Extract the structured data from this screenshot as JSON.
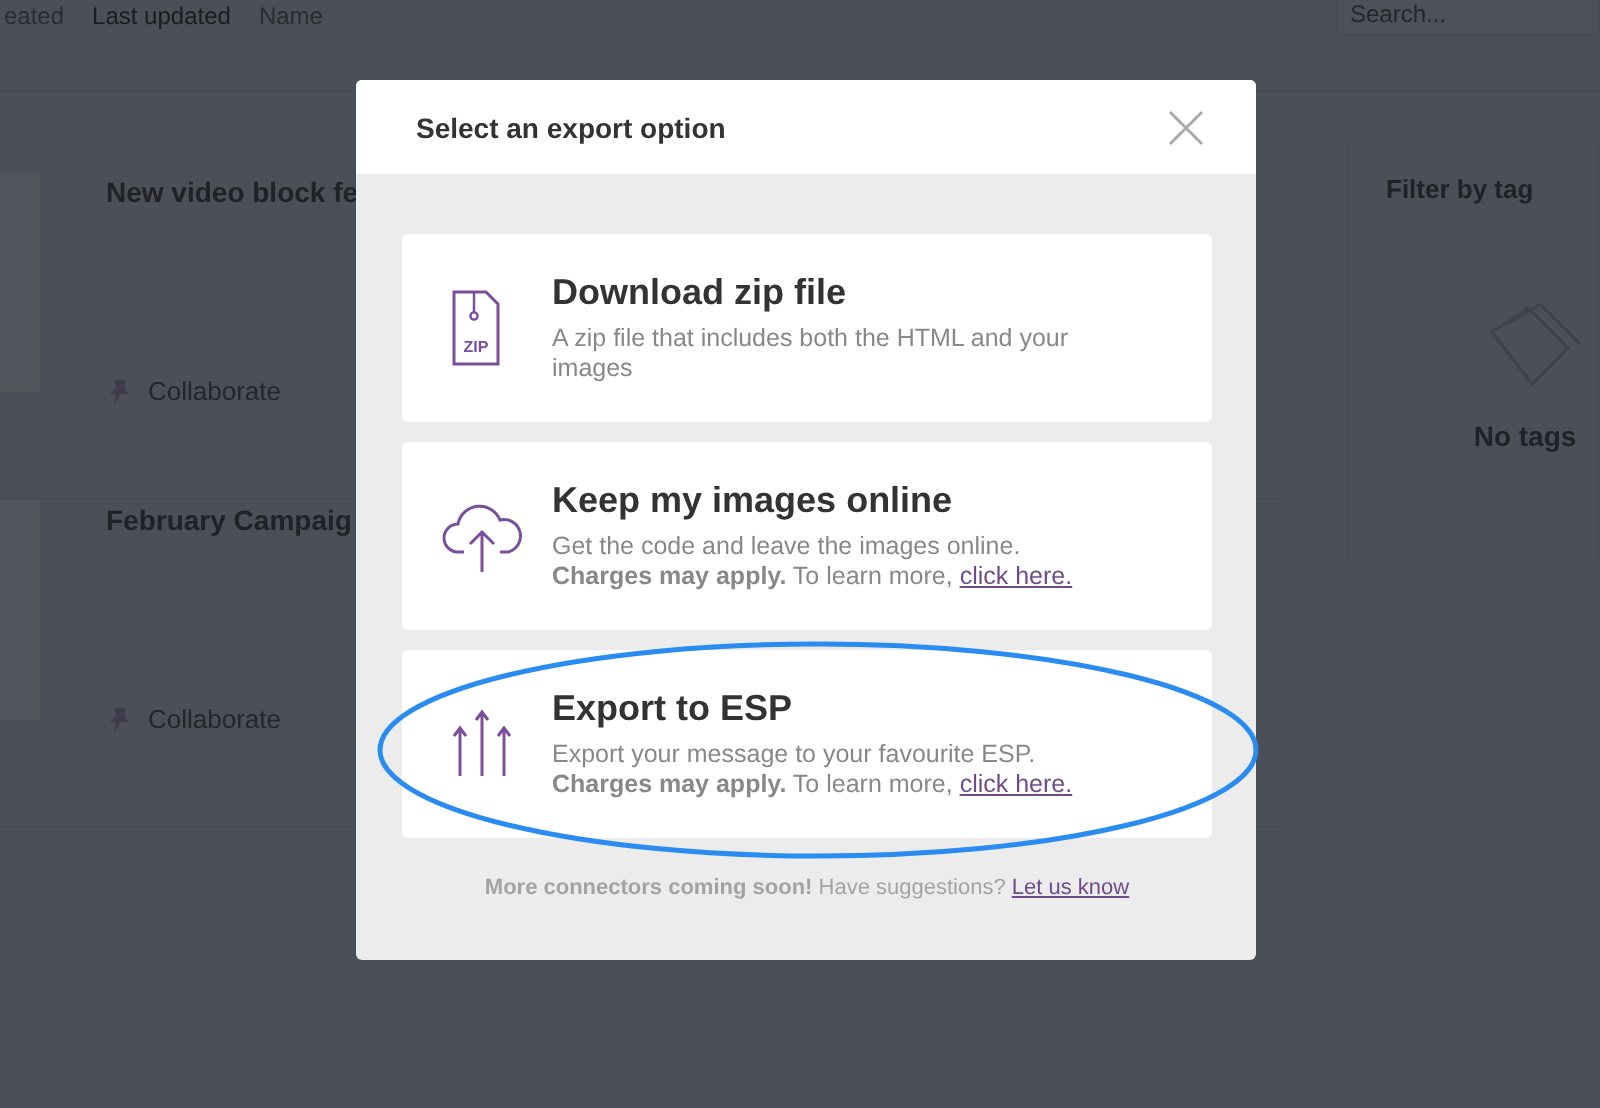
{
  "background": {
    "sort_options": [
      {
        "label": "eated",
        "selected": false
      },
      {
        "label": "Last updated",
        "selected": true
      },
      {
        "label": "Name",
        "selected": false
      }
    ],
    "search": {
      "placeholder": "Search..."
    },
    "campaigns": [
      {
        "title": "New video block fe",
        "action": "Collaborate"
      },
      {
        "title": "February Campaig",
        "action": "Collaborate"
      }
    ],
    "filter": {
      "title": "Filter by tag",
      "empty_text": "No tags"
    }
  },
  "dialog": {
    "title": "Select an export option",
    "options": [
      {
        "kind": "zip",
        "icon_text": "ZIP",
        "title": "Download zip file",
        "description": "A zip file that includes both the HTML and your images"
      },
      {
        "kind": "cloud",
        "title": "Keep my images online",
        "description": "Get the code and leave the images online.",
        "note": "**Charges may apply.** To learn more,",
        "link": "click here."
      },
      {
        "kind": "arrows",
        "title": "Export to ESP",
        "description": "Export your message to your favourite ESP.",
        "note": "**Charges may apply.** To learn more,",
        "link": "click here."
      }
    ],
    "footer": {
      "text": "**More connectors coming soon!** Have suggestions?",
      "link": "Let us know"
    }
  }
}
